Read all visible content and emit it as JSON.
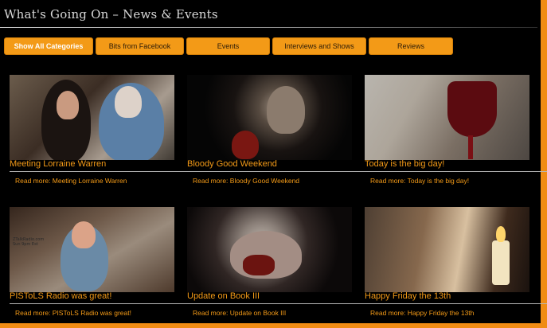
{
  "page": {
    "title": "What's Going On – News & Events"
  },
  "filters": [
    {
      "label": "Show All Categories",
      "active": true
    },
    {
      "label": "Bits from Facebook",
      "active": false
    },
    {
      "label": "Events",
      "active": false
    },
    {
      "label": "Interviews and Shows",
      "active": false
    },
    {
      "label": "Reviews",
      "active": false
    }
  ],
  "articles": [
    {
      "title": "Meeting Lorraine Warren",
      "read_more": "Read more: Meeting Lorraine Warren"
    },
    {
      "title": "Bloody Good Weekend",
      "read_more": "Read more: Bloody Good Weekend"
    },
    {
      "title": "Today is the big day!",
      "read_more": "Read more: Today is the big day!"
    },
    {
      "title": "PISToLS Radio was great!",
      "read_more": "Read more: PISToLS Radio was great!"
    },
    {
      "title": "Update on Book III",
      "read_more": "Read more: Update on Book III"
    },
    {
      "title": "Happy Friday the 13th",
      "read_more": "Read more: Happy Friday the 13th"
    }
  ],
  "image_text": {
    "pistols_overlay": "ZTalkRadio.com Sun 9pm Est"
  },
  "colors": {
    "accent": "#f39a17",
    "frame": "#f08c14",
    "background": "#000000"
  }
}
